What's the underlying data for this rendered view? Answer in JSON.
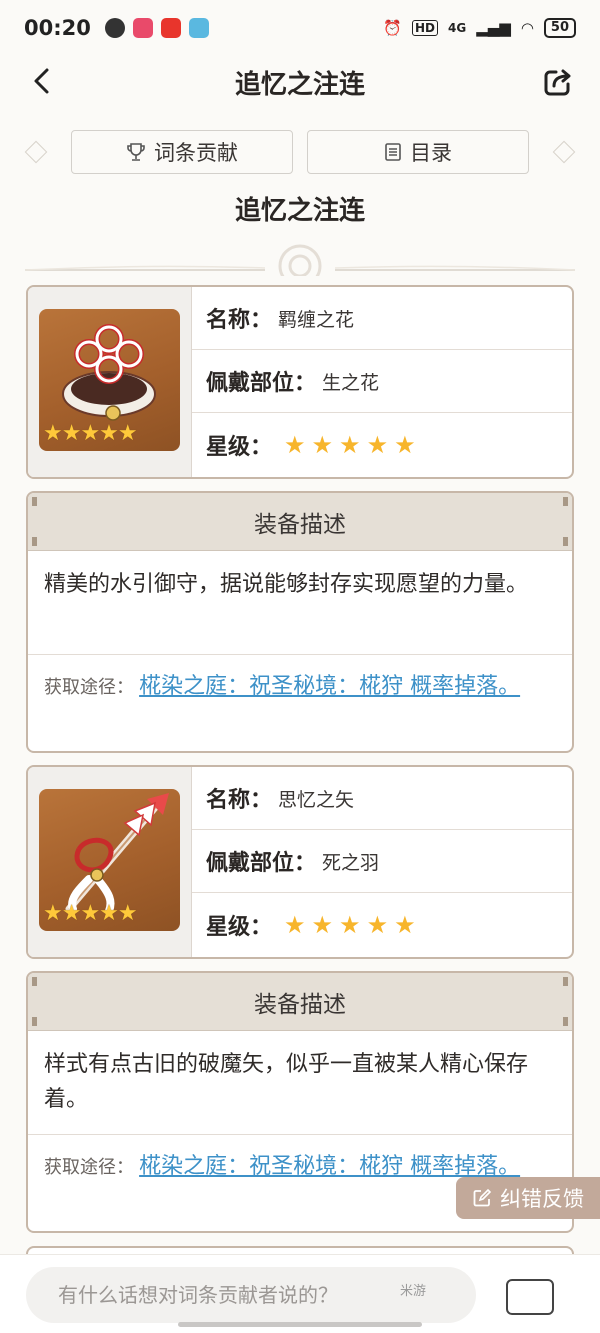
{
  "status_bar": {
    "time": "00:20",
    "network": "4G",
    "signal": "HD",
    "battery": "50"
  },
  "header": {
    "title": "追忆之注连"
  },
  "entry_buttons": {
    "contribute": "词条贡献",
    "catalog": "目录"
  },
  "page_title": "追忆之注连",
  "items": [
    {
      "name_label": "名称：",
      "name": "羁缠之花",
      "slot_label": "佩戴部位：",
      "slot": "生之花",
      "rarity_label": "星级：",
      "stars": 5,
      "thumbnail_stars": "★★★★★",
      "desc_title": "装备描述",
      "description": "精美的水引御守，据说能够封存实现愿望的力量。",
      "source_label": "获取途径：",
      "source_link": "椛染之庭：祝圣秘境：椛狩 概率掉落。"
    },
    {
      "name_label": "名称：",
      "name": "思忆之矢",
      "slot_label": "佩戴部位：",
      "slot": "死之羽",
      "rarity_label": "星级：",
      "stars": 5,
      "thumbnail_stars": "★★★★★",
      "desc_title": "装备描述",
      "description": "样式有点古旧的破魔矢，似乎一直被某人精心保存着。",
      "source_label": "获取途径：",
      "source_link": "椛染之庭：祝圣秘境：椛狩 概率掉落。"
    }
  ],
  "feedback_button": "纠错反馈",
  "comment": {
    "placeholder": "有什么话想对词条贡献者说的？"
  },
  "watermark": "米游",
  "colors": {
    "accent_link": "#3d91c8",
    "card_border": "#c7b7a8",
    "star": "#f7b52c",
    "feedback_bg": "#c2a99a"
  }
}
